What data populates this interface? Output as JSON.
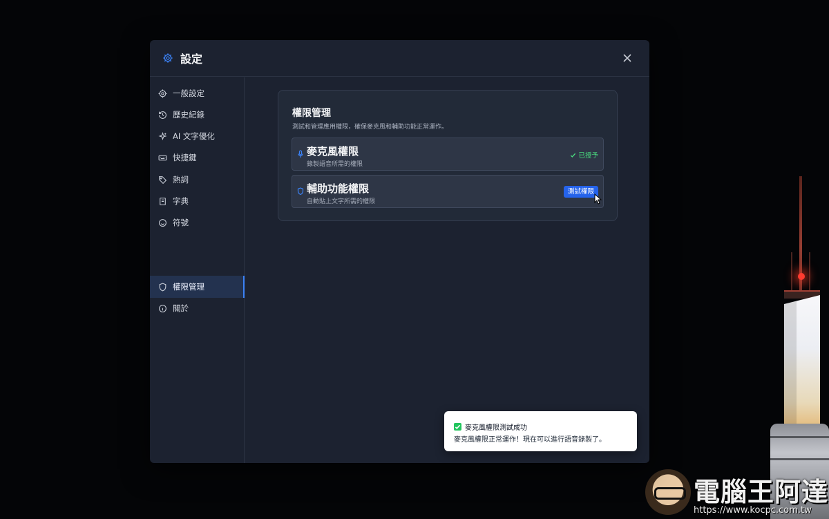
{
  "dialog": {
    "title": "設定"
  },
  "sidebar": {
    "items": [
      {
        "label": "一般設定",
        "icon": "gear-icon"
      },
      {
        "label": "歷史紀錄",
        "icon": "history-icon"
      },
      {
        "label": "AI 文字優化",
        "icon": "sparkles-icon"
      },
      {
        "label": "快捷鍵",
        "icon": "keyboard-icon"
      },
      {
        "label": "熱詞",
        "icon": "tag-icon"
      },
      {
        "label": "字典",
        "icon": "book-icon"
      },
      {
        "label": "符號",
        "icon": "smile-icon"
      },
      {
        "label": "權限管理",
        "icon": "shield-icon",
        "active": true
      },
      {
        "label": "關於",
        "icon": "info-icon"
      }
    ]
  },
  "permissions": {
    "title": "權限管理",
    "subtitle": "測試和管理應用權限，確保麥克風和輔助功能正常運作。",
    "microphone": {
      "name": "麥克風權限",
      "desc": "錄製語音所需的權限",
      "status": "已授予"
    },
    "accessibility": {
      "name": "輔助功能權限",
      "desc": "自動貼上文字所需的權限",
      "button": "測試權限"
    }
  },
  "toast": {
    "title": "麥克風權限測試成功",
    "message": "麥克風權限正常運作！現在可以進行語音錄製了。"
  },
  "watermark": {
    "title": "電腦王阿達",
    "url": "https://www.kocpc.com.tw"
  },
  "colors": {
    "accent": "#3b82f6",
    "success": "#4ade80",
    "button": "#2563eb"
  }
}
